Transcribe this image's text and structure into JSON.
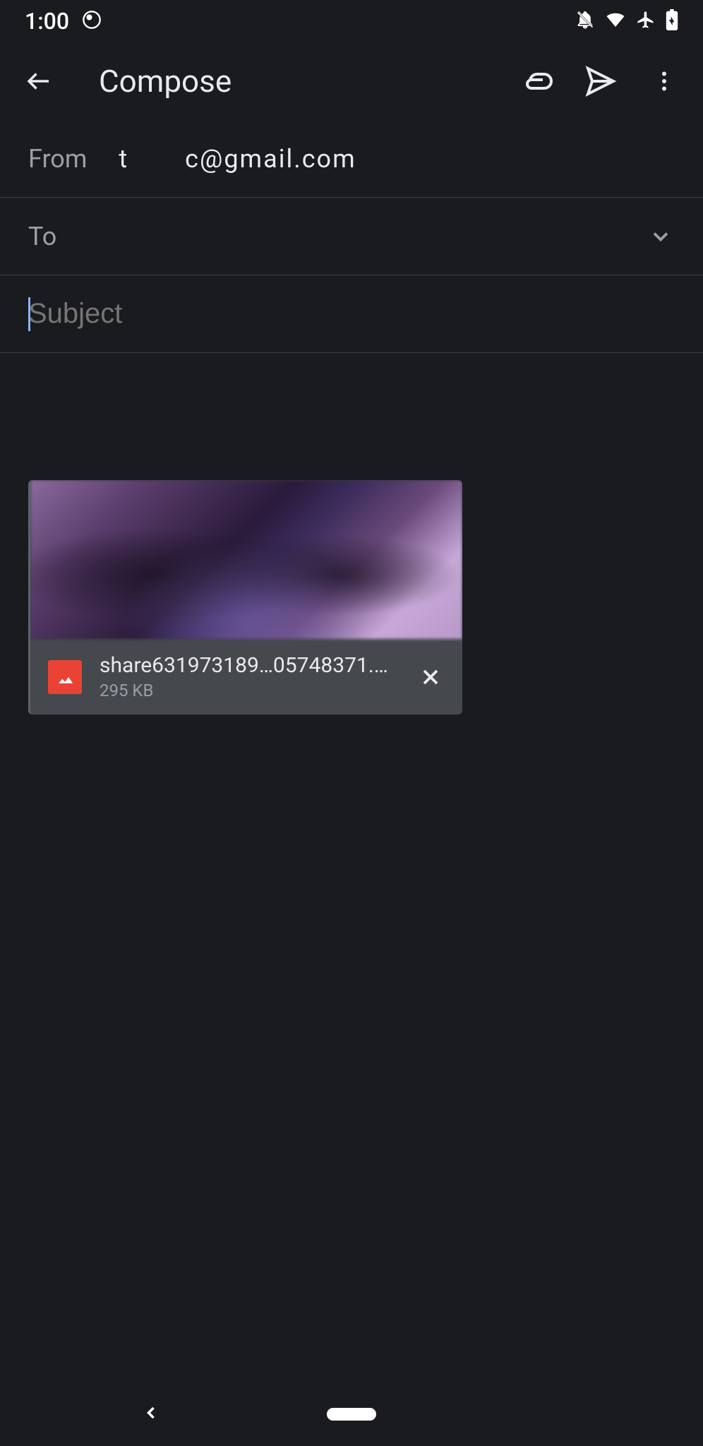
{
  "status": {
    "time": "1:00"
  },
  "header": {
    "title": "Compose"
  },
  "from": {
    "label": "From",
    "email_part1": "t",
    "email_part2": "c@gmail.com"
  },
  "to": {
    "label": "To"
  },
  "subject": {
    "placeholder": "Subject"
  },
  "attachment": {
    "name": "share631973189…05748371.png",
    "size": "295 KB"
  }
}
